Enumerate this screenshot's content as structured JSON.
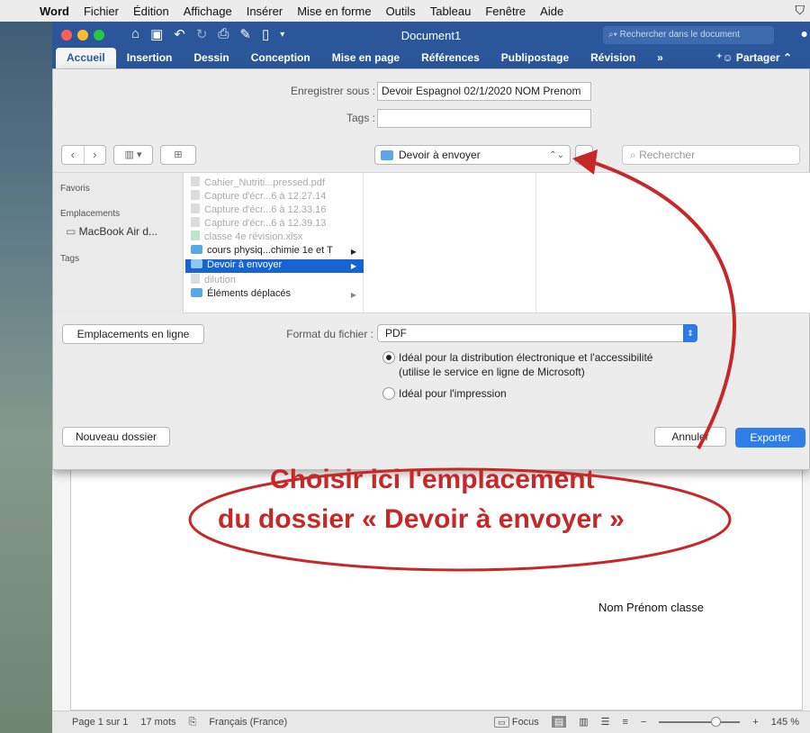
{
  "menubar": {
    "app": "Word",
    "items": [
      "Fichier",
      "Édition",
      "Affichage",
      "Insérer",
      "Mise en forme",
      "Outils",
      "Tableau",
      "Fenêtre",
      "Aide"
    ]
  },
  "titlebar": {
    "title": "Document1",
    "search_placeholder": "Rechercher dans le document"
  },
  "ribbon": {
    "tabs": [
      "Accueil",
      "Insertion",
      "Dessin",
      "Conception",
      "Mise en page",
      "Références",
      "Publipostage",
      "Révision",
      "»"
    ],
    "active_tab": "Accueil",
    "share": "Partager"
  },
  "save_dialog": {
    "save_as_label": "Enregistrer sous :",
    "save_as_value": "Devoir Espagnol 02/1/2020 NOM Prenom",
    "tags_label": "Tags :",
    "tags_value": "",
    "location": "Devoir à envoyer",
    "search_placeholder": "Rechercher",
    "sidebar": {
      "favorites_header": "Favoris",
      "locations_header": "Emplacements",
      "locations": [
        "MacBook Air d..."
      ],
      "tags_header": "Tags"
    },
    "files": [
      {
        "name": "Cahier_Nutriti...pressed.pdf",
        "dim": true,
        "folder": false
      },
      {
        "name": "Capture d'écr...6 à 12.27.14",
        "dim": true,
        "folder": false
      },
      {
        "name": "Capture d'écr...6 à 12.33.16",
        "dim": true,
        "folder": false
      },
      {
        "name": "Capture d'écr...6 à 12.39.13",
        "dim": true,
        "folder": false
      },
      {
        "name": "classe 4e révision.xlsx",
        "dim": true,
        "folder": false
      },
      {
        "name": "cours physiq...chimie 1e et T",
        "dim": false,
        "folder": true
      },
      {
        "name": "Devoir à envoyer",
        "dim": false,
        "folder": true,
        "selected": true
      },
      {
        "name": "dilution",
        "dim": true,
        "folder": false
      },
      {
        "name": "Éléments déplacés",
        "dim": false,
        "folder": true
      }
    ],
    "online_locations_button": "Emplacements en ligne",
    "format_label": "Format du fichier :",
    "format_value": "PDF",
    "option1_line1": "Idéal pour la distribution électronique et l'accessibilité",
    "option1_line2": "(utilise le service en ligne de Microsoft)",
    "option2": "Idéal pour l'impression",
    "new_folder_button": "Nouveau dossier",
    "cancel_button": "Annuler",
    "export_button": "Exporter"
  },
  "document": {
    "text": "Nom Prénom classe"
  },
  "annotation": {
    "line1": "Choisir ici l'emplacement",
    "line2": "du dossier  « Devoir à envoyer »",
    "color": "#c62828"
  },
  "statusbar": {
    "page": "Page 1 sur 1",
    "words": "17 mots",
    "language": "Français (France)",
    "focus": "Focus",
    "zoom": "145 %"
  },
  "colors": {
    "word_blue": "#2b579a",
    "accent_blue": "#2f7ee8"
  }
}
